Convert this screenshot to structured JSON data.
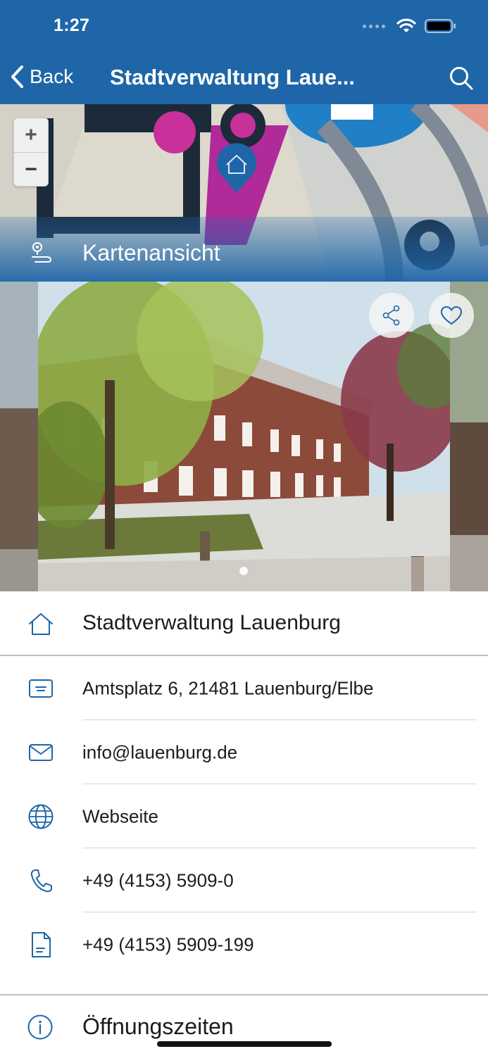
{
  "status_bar": {
    "time": "1:27"
  },
  "nav": {
    "back_label": "Back",
    "title": "Stadtverwaltung Laue..."
  },
  "map": {
    "zoom_in_label": "+",
    "zoom_out_label": "−",
    "caption": "Kartenansicht"
  },
  "info": {
    "name": "Stadtverwaltung Lauenburg",
    "address": "Amtsplatz 6, 21481 Lauenburg/Elbe",
    "email": "info@lauenburg.de",
    "website": "Webseite",
    "phone": "+49 (4153) 5909-0",
    "fax": "+49 (4153) 5909-199"
  },
  "opening_hours_label": "Öffnungszeiten",
  "icons": {
    "back": "chevron-left-icon",
    "search": "search-icon",
    "map_pin": "home-pin-icon",
    "route": "location-route-icon",
    "share": "share-icon",
    "favorite": "heart-icon",
    "name": "home-icon",
    "address": "address-card-icon",
    "email": "envelope-icon",
    "website": "globe-icon",
    "phone": "phone-icon",
    "fax": "document-icon",
    "hours": "info-icon"
  },
  "colors": {
    "brand": "#1e66a8",
    "icon": "#1e66a8",
    "divider": "#d6d6d8"
  }
}
